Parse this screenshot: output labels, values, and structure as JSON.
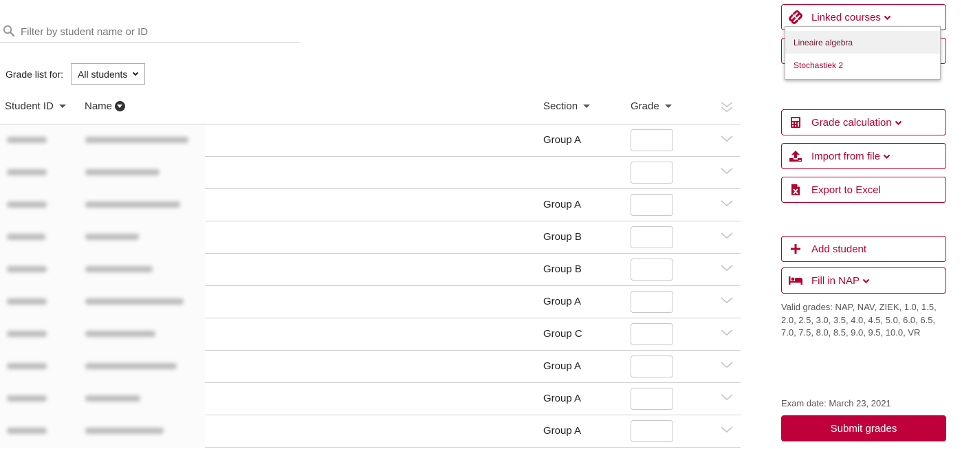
{
  "colors": {
    "brand": "#b8002f",
    "submit_bg": "#c0003a",
    "dropdown_active_bg": "#f0f0f0"
  },
  "search": {
    "placeholder": "Filter by student name or ID",
    "value": "",
    "icon": "search-icon"
  },
  "grade_list_for": {
    "label": "Grade list for:",
    "selected": "All students"
  },
  "table": {
    "columns": {
      "student_id": "Student ID",
      "name": "Name",
      "section": "Section",
      "grade": "Grade"
    },
    "sorted_by": "Name",
    "rows": [
      {
        "student_id": "[redacted]",
        "name": "[redacted]",
        "section": "Group A",
        "grade": ""
      },
      {
        "student_id": "[redacted]",
        "name": "[redacted]",
        "section": "",
        "grade": ""
      },
      {
        "student_id": "[redacted]",
        "name": "[redacted]",
        "section": "Group A",
        "grade": ""
      },
      {
        "student_id": "[redacted]",
        "name": "[redacted]",
        "section": "Group B",
        "grade": ""
      },
      {
        "student_id": "[redacted]",
        "name": "[redacted]",
        "section": "Group B",
        "grade": ""
      },
      {
        "student_id": "[redacted]",
        "name": "[redacted]",
        "section": "Group A",
        "grade": ""
      },
      {
        "student_id": "[redacted]",
        "name": "[redacted]",
        "section": "Group C",
        "grade": ""
      },
      {
        "student_id": "[redacted]",
        "name": "[redacted]",
        "section": "Group A",
        "grade": ""
      },
      {
        "student_id": "[redacted]",
        "name": "[redacted]",
        "section": "Group A",
        "grade": ""
      },
      {
        "student_id": "[redacted]",
        "name": "[redacted]",
        "section": "Group A",
        "grade": ""
      }
    ]
  },
  "sidebar": {
    "linked_courses": {
      "label": "Linked courses",
      "icon": "link-icon",
      "menu_items": [
        "Lineaire algebra",
        "Stochastiek 2"
      ],
      "highlighted_item": "Lineaire algebra"
    },
    "grade_calculation": {
      "label": "Grade calculation",
      "icon": "calculator-icon"
    },
    "import_from_file": {
      "label": "Import from file",
      "icon": "upload-icon"
    },
    "export_to_excel": {
      "label": "Export to Excel",
      "icon": "excel-file-icon"
    },
    "add_student": {
      "label": "Add student",
      "icon": "plus-icon"
    },
    "fill_in_nap": {
      "label": "Fill in NAP",
      "icon": "bed-icon"
    },
    "valid_grades": "Valid grades: NAP, NAV, ZIEK, 1.0, 1.5, 2.0, 2.5, 3.0, 3.5, 4.0, 4.5, 5.0, 6.0, 6.5, 7.0, 7.5, 8.0, 8.5, 9.0, 9.5, 10.0, VR",
    "exam_date": "Exam date: March 23, 2021",
    "submit_label": "Submit grades"
  }
}
